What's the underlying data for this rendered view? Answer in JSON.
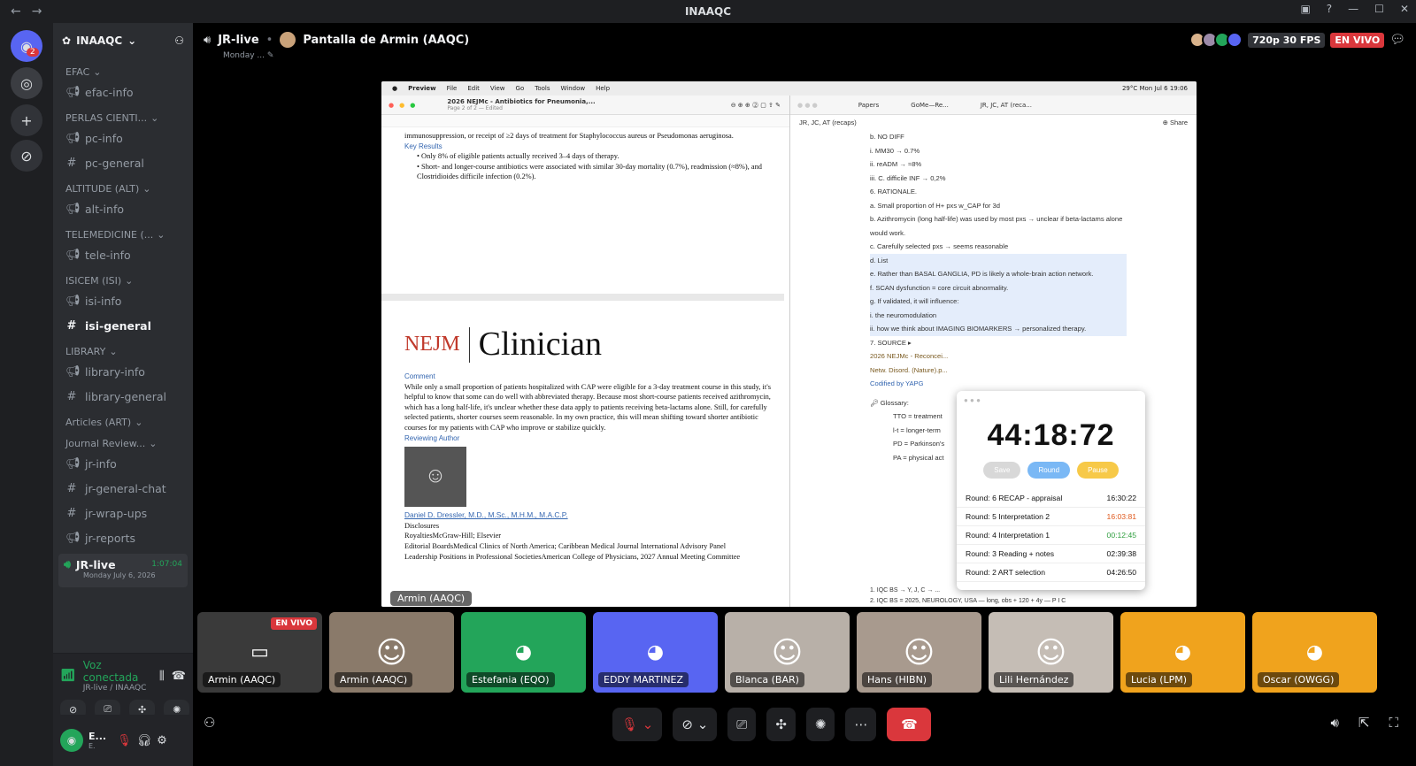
{
  "window": {
    "title": "INAAQC"
  },
  "server": {
    "name": "INAAQC"
  },
  "guild_badge": "2",
  "categories": [
    {
      "label": "EFAC",
      "channels": [
        {
          "name": "efac-info",
          "type": "announce"
        }
      ]
    },
    {
      "label": "PERLAS CIENTI...",
      "channels": [
        {
          "name": "pc-info",
          "type": "announce"
        },
        {
          "name": "pc-general",
          "type": "text"
        }
      ]
    },
    {
      "label": "ALTITUDE (ALT)",
      "channels": [
        {
          "name": "alt-info",
          "type": "announce"
        }
      ]
    },
    {
      "label": "TELEMEDICINE (...",
      "channels": [
        {
          "name": "tele-info",
          "type": "announce"
        }
      ]
    },
    {
      "label": "ISICEM (ISI)",
      "channels": [
        {
          "name": "isi-info",
          "type": "announce"
        },
        {
          "name": "isi-general",
          "type": "text",
          "active": true
        }
      ]
    },
    {
      "label": "LIBRARY",
      "channels": [
        {
          "name": "library-info",
          "type": "announce"
        },
        {
          "name": "library-general",
          "type": "text"
        }
      ]
    },
    {
      "label": "Articles (ART)",
      "channels": []
    },
    {
      "label": "Journal Review...",
      "channels": [
        {
          "name": "jr-info",
          "type": "announce"
        },
        {
          "name": "jr-general-chat",
          "type": "text"
        },
        {
          "name": "jr-wrap-ups",
          "type": "text"
        },
        {
          "name": "jr-reports",
          "type": "announce"
        }
      ]
    }
  ],
  "voice_channel": {
    "name": "JR-live",
    "time": "1:07:04",
    "subtitle": "Monday July 6, 2026"
  },
  "voice_panel": {
    "status": "Voz conectada",
    "location": "JR-live / INAAQC"
  },
  "user_panel": {
    "name": "E...",
    "sub": "E."
  },
  "stage": {
    "channel": "JR-live",
    "stream_title": "Pantalla de Armin (AAQC)",
    "subtitle": "Monday ...",
    "quality": "720p 30 FPS",
    "live": "EN VIVO"
  },
  "mac": {
    "menu": [
      "Preview",
      "File",
      "Edit",
      "View",
      "Go",
      "Tools",
      "Window",
      "Help"
    ],
    "status": "29°C  Mon Jul 6 19:06"
  },
  "preview": {
    "doc_title": "2026 NEJMc - Antibiotics for Pneumonia,...",
    "doc_sub": "Page 2 of 2 — Edited",
    "top_text": "immunosuppression, or receipt of ≥2 days of treatment for Staphylococcus aureus or Pseudomonas aeruginosa.",
    "key_results": "Key Results",
    "bullet1": "Only 8% of eligible patients actually received 3–4 days of therapy.",
    "bullet2": "Short- and longer-course antibiotics were associated with similar 30-day mortality (0.7%), readmission (≈8%), and Clostridioides difficile infection (0.2%).",
    "logo": "NEJM",
    "clinician": "Clinician",
    "comment_label": "Comment",
    "comment": "While only a small proportion of patients hospitalized with CAP were eligible for a 3-day treatment course in this study, it's helpful to know that some can do well with abbreviated therapy. Because most short-course patients received azithromycin, which has a long half-life, it's unclear whether these data apply to patients receiving beta-lactams alone. Still, for carefully selected patients, shorter courses seem reasonable. In my own practice, this will mean shifting toward shorter antibiotic courses for my patients with CAP who improve or stabilize quickly.",
    "reviewing_author": "Reviewing Author",
    "author": "Daniel D. Dressler, M.D., M.Sc., M.H.M., M.A.C.P.",
    "disclosures": "Disclosures",
    "royalties": "RoyaltiesMcGraw-Hill; Elsevier",
    "editorial": "Editorial BoardsMedical Clinics of North America; Caribbean Medical Journal International Advisory Panel",
    "leadership": "Leadership Positions in Professional SocietiesAmerican College of Physicians, 2027 Annual Meeting Committee",
    "page_label": "Armin (AAQC)"
  },
  "notes": {
    "tabs": [
      "Papers",
      "GoMe—Re...",
      "JR, JC, AT (reca..."
    ],
    "breadcrumb": "JR, JC, AT (recaps)",
    "share": "Share",
    "lines": [
      "b.  NO DIFF",
      "i.   MM30 → 0.7%",
      "ii.  reADM → ≈8%",
      "iii. C. difficile INF → 0,2%",
      "6.  RATIONALE.",
      "a.  Small proportion of H+ pxs w_CAP for 3d",
      "b.  Azithromycin (long half-life) was used by most pxs → unclear if beta-lactams alone would work.",
      "c.  Carefully selected pxs → seems reasonable",
      "d.  List",
      "e.  Rather than BASAL GANGLIA, PD is likely a whole-brain action network.",
      "f.  SCAN dysfunction = core circuit abnormality.",
      "g.  If validated, it will influence:",
      "i.   the neuromodulation",
      "ii.  how we think about IMAGING BIOMARKERS → personalized therapy.",
      "7.  SOURCE ▸"
    ],
    "source": "2026 NEJMc - Reconcei...",
    "source2": "Netw. Disord. (Nature).p...",
    "codified": "Codified by YAPG",
    "glossary": "Glossary:",
    "gloss": [
      "TTO = treatment",
      "l-t = longer-term",
      "PD = Parkinson's",
      "PA = physical act"
    ],
    "bottom1": "1.  IQC BS → Y, J, C → ...",
    "bottom2": "2.  IQC BS = 2025, NEUROLOGY, USA — long, obs + 120 + 4y — P I C"
  },
  "timer": {
    "time": "44:18:72",
    "buttons": [
      "Save",
      "Round",
      "Pause"
    ],
    "rounds": [
      {
        "label": "Round: 6  RECAP - appraisal",
        "time": "16:30:22",
        "color": "#111111"
      },
      {
        "label": "Round: 5  Interpretation 2",
        "time": "16:03:81",
        "color": "#e05a1e"
      },
      {
        "label": "Round: 4  Interpretation 1",
        "time": "00:12:45",
        "color": "#2e9e3e"
      },
      {
        "label": "Round: 3  Reading + notes",
        "time": "02:39:38",
        "color": "#111111"
      },
      {
        "label": "Round: 2  ART selection",
        "time": "04:26:50",
        "color": "#111111"
      }
    ]
  },
  "tiles": [
    {
      "label": "Armin (AAQC)",
      "bg": "#3a3a3a",
      "kind": "screen",
      "live": "EN VIVO"
    },
    {
      "label": "Armin (AAQC)",
      "bg": "#8a7a6a",
      "kind": "camera"
    },
    {
      "label": "Estefania (EQO)",
      "bg": "#23a55a",
      "kind": "discord"
    },
    {
      "label": "EDDY MARTINEZ",
      "bg": "#5865f2",
      "kind": "discord"
    },
    {
      "label": "Blanca (BAR)",
      "bg": "#b8b0a8",
      "kind": "camera"
    },
    {
      "label": "Hans (HIBN)",
      "bg": "#a89a8e",
      "kind": "camera"
    },
    {
      "label": "Lili Hernández",
      "bg": "#c5bdb5",
      "kind": "camera"
    },
    {
      "label": "Lucia (LPM)",
      "bg": "#f0a31d",
      "kind": "discord"
    },
    {
      "label": "Oscar (OWGG)",
      "bg": "#f0a31d",
      "kind": "discord"
    }
  ],
  "colors": {
    "accent": "#5865f2",
    "live": "#da373c",
    "green": "#23a55a"
  }
}
